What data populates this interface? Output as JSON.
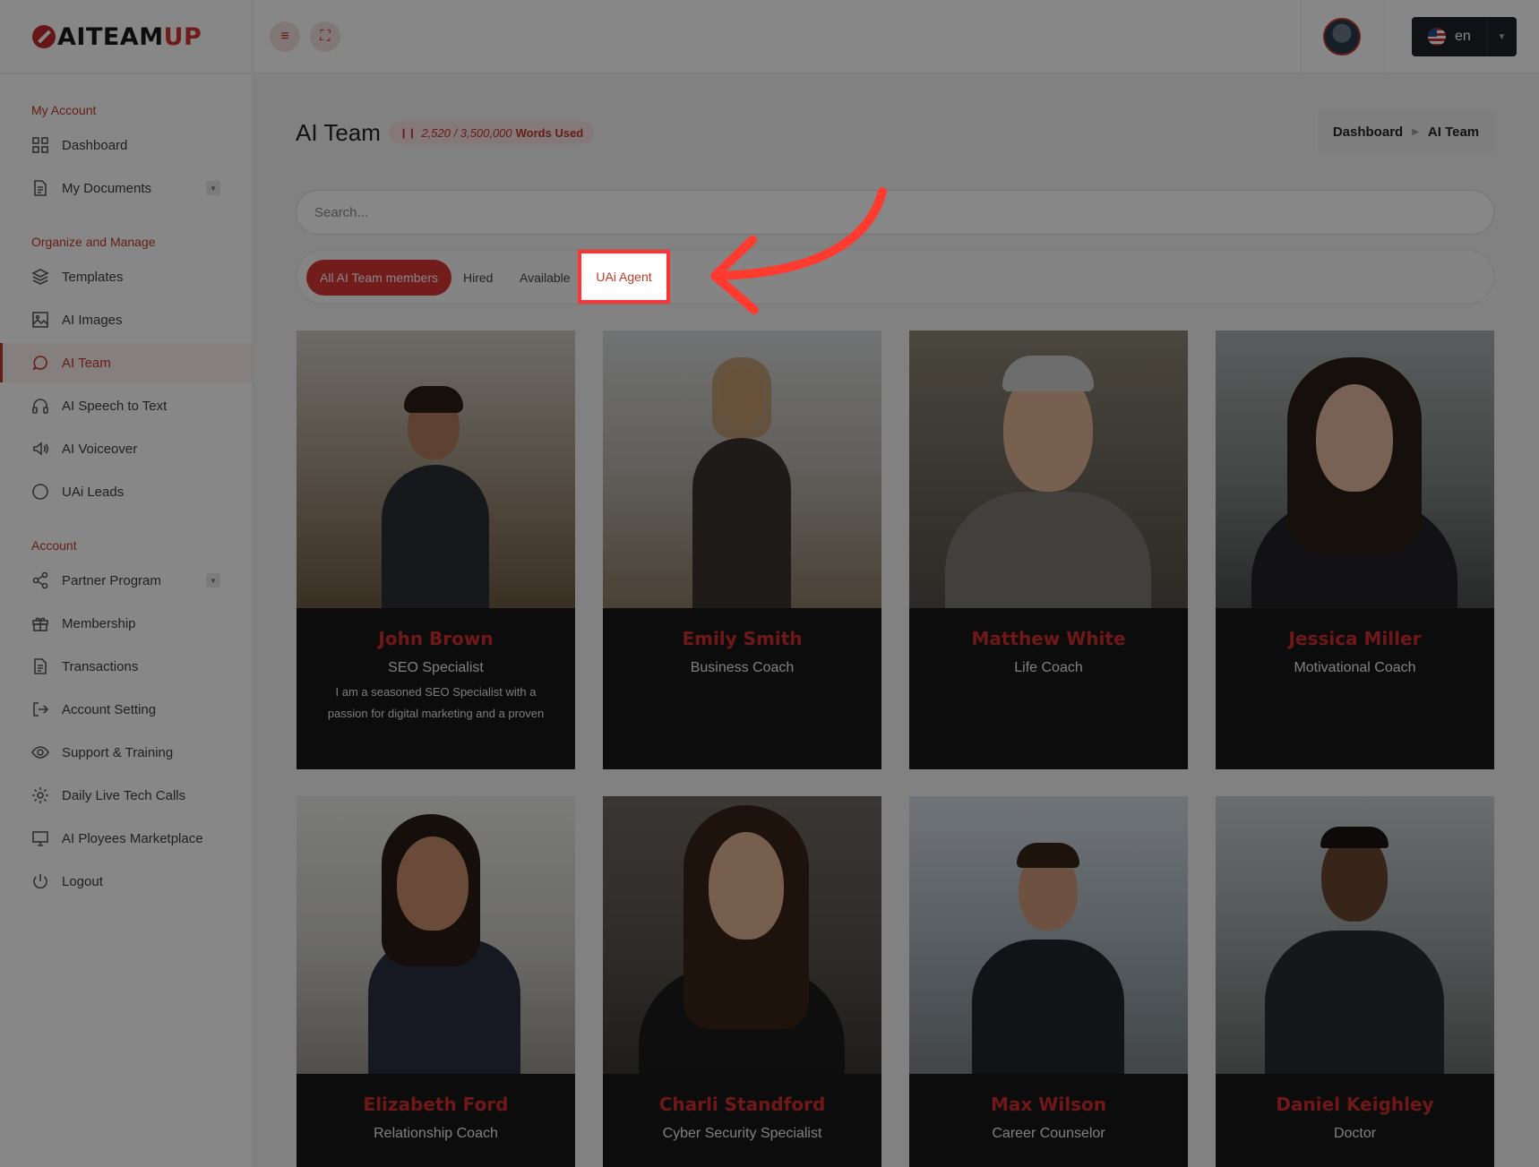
{
  "header": {
    "logo_text": "AITEAM",
    "logo_accent": "UP",
    "menu_icon": "hamburger-icon",
    "fullscreen_icon": "fullscreen-icon",
    "language": "en"
  },
  "sidebar": {
    "sections": [
      {
        "title": "My Account"
      },
      {
        "title": "Organize and Manage"
      },
      {
        "title": "Account"
      }
    ],
    "items": [
      {
        "label": "Dashboard",
        "icon": "grid-icon"
      },
      {
        "label": "My Documents",
        "icon": "document-icon"
      },
      {
        "label": "Templates",
        "icon": "layers-icon"
      },
      {
        "label": "AI Images",
        "icon": "image-icon"
      },
      {
        "label": "AI Team",
        "icon": "chat-icon"
      },
      {
        "label": "AI Speech to Text",
        "icon": "headphones-icon"
      },
      {
        "label": "AI Voiceover",
        "icon": "speaker-icon"
      },
      {
        "label": "UAi Leads",
        "icon": "circle-icon"
      },
      {
        "label": "Partner Program",
        "icon": "share-icon"
      },
      {
        "label": "Membership",
        "icon": "gift-icon"
      },
      {
        "label": "Transactions",
        "icon": "receipt-icon"
      },
      {
        "label": "Account Setting",
        "icon": "logout-arrow-icon"
      },
      {
        "label": "Support & Training",
        "icon": "eye-icon"
      },
      {
        "label": "Daily Live Tech Calls",
        "icon": "gear-icon"
      },
      {
        "label": "AI Ployees Marketplace",
        "icon": "monitor-icon"
      },
      {
        "label": "Logout",
        "icon": "power-icon"
      }
    ]
  },
  "main": {
    "title": "AI Team",
    "words_used": "2,520 / 3,500,000",
    "words_suffix": "Words Used",
    "breadcrumb": {
      "home": "Dashboard",
      "current": "AI Team"
    },
    "search_placeholder": "Search...",
    "filters": [
      "All AI Team members",
      "Hired",
      "Available",
      "UAi Agent"
    ],
    "members": [
      {
        "name": "John Brown",
        "role": "SEO Specialist",
        "description": "I am a seasoned SEO Specialist with a passion for digital marketing and a proven"
      },
      {
        "name": "Emily Smith",
        "role": "Business Coach",
        "description": ""
      },
      {
        "name": "Matthew White",
        "role": "Life Coach",
        "description": ""
      },
      {
        "name": "Jessica Miller",
        "role": "Motivational Coach",
        "description": ""
      },
      {
        "name": "Elizabeth Ford",
        "role": "Relationship Coach",
        "description": ""
      },
      {
        "name": "Charli Standford",
        "role": "Cyber Security Specialist",
        "description": ""
      },
      {
        "name": "Max Wilson",
        "role": "Career Counselor",
        "description": ""
      },
      {
        "name": "Daniel Keighley",
        "role": "Doctor",
        "description": ""
      }
    ]
  },
  "colors": {
    "accent": "#d32f2f",
    "highlight_box": "#ff3333",
    "card_bg": "#171717"
  }
}
